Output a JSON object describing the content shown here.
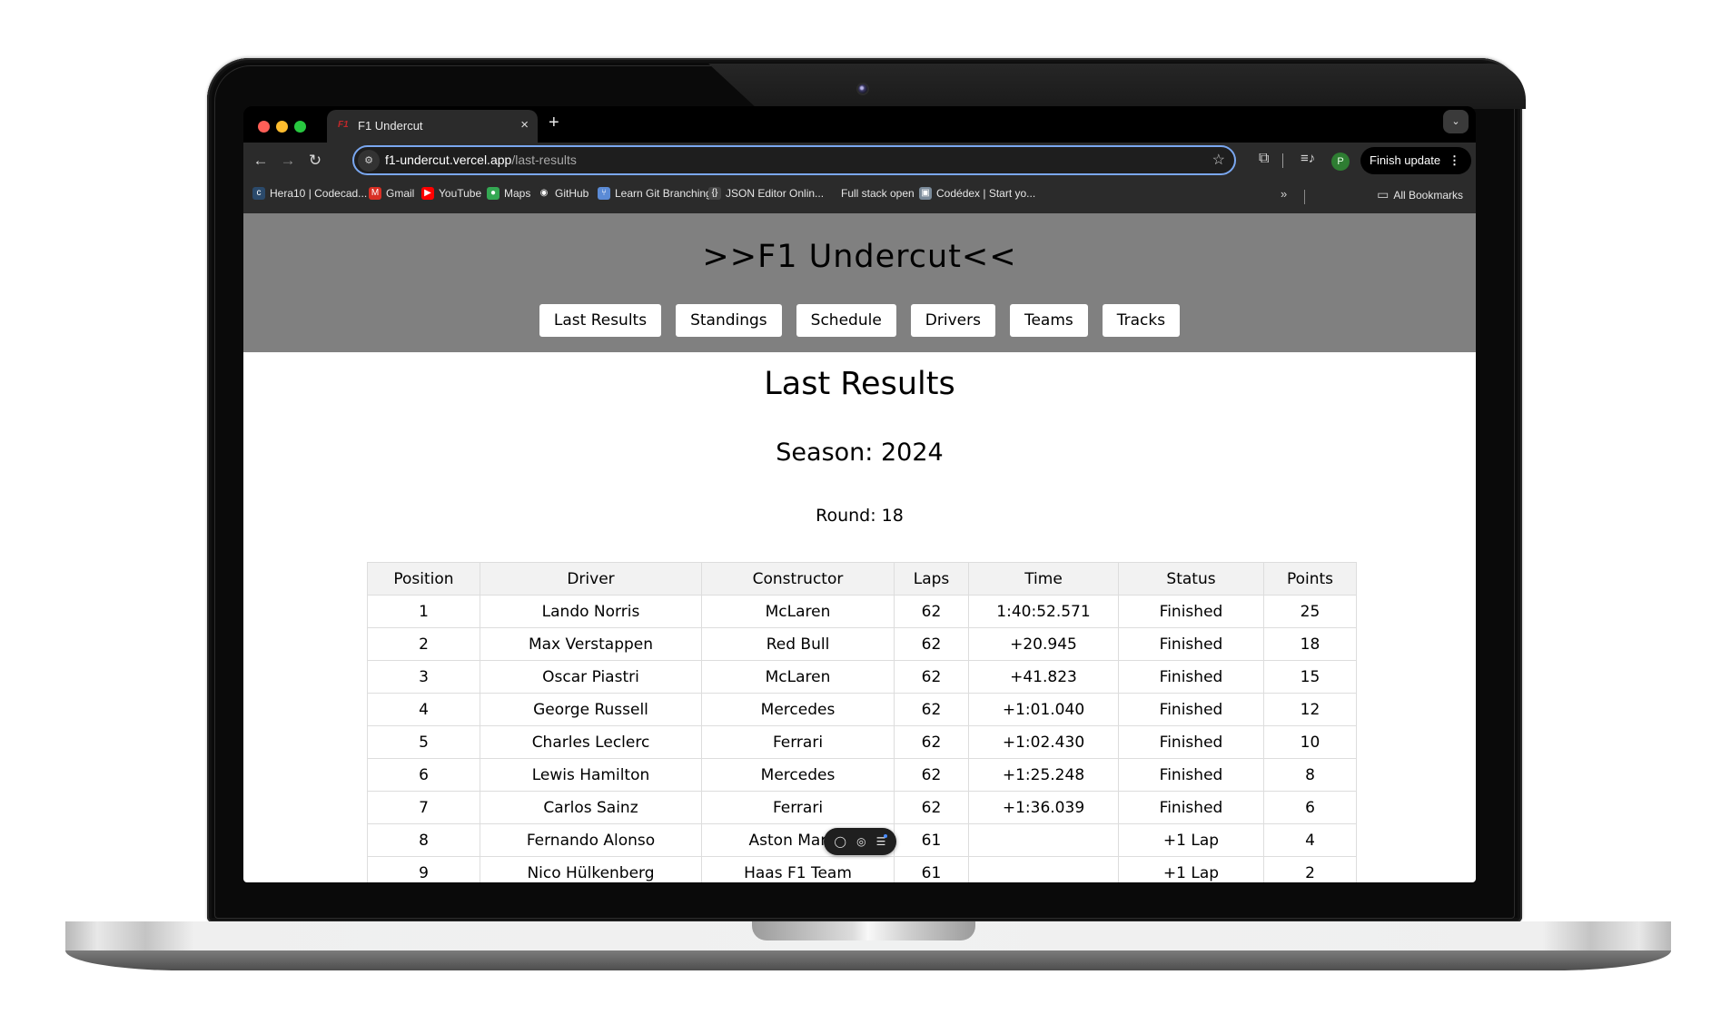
{
  "browser": {
    "tab": {
      "title": "F1 Undercut",
      "favicon": "F1",
      "close": "×"
    },
    "new_tab": "+",
    "tab_search": "⌄",
    "nav": {
      "back": "←",
      "forward": "→",
      "reload": "↻"
    },
    "url": {
      "host": "f1-undercut.vercel.app",
      "path": "/last-results"
    },
    "star": "☆",
    "extensions": "⧉",
    "media": "≡♪",
    "profile_initial": "P",
    "finish_update": "Finish update",
    "menu_dots": "⋮",
    "bookmarks": [
      {
        "label": "Hera10 | Codecad...",
        "icon": "codecademy-icon",
        "glyph": "c",
        "color": "#2b4a6b"
      },
      {
        "label": "Gmail",
        "icon": "gmail-icon",
        "glyph": "M",
        "color": "#d93025"
      },
      {
        "label": "YouTube",
        "icon": "youtube-icon",
        "glyph": "▶",
        "color": "#ff0000"
      },
      {
        "label": "Maps",
        "icon": "maps-pin-icon",
        "glyph": "●",
        "color": "#34a853"
      },
      {
        "label": "GitHub",
        "icon": "github-icon",
        "glyph": "◉",
        "color": "#2b2b2b"
      },
      {
        "label": "Learn Git Branching",
        "icon": "git-branching-icon",
        "glyph": "⑂",
        "color": "#5b8bd6"
      },
      {
        "label": "JSON Editor Onlin...",
        "icon": "braces-icon",
        "glyph": "{}",
        "color": "#444444"
      },
      {
        "label": "Full stack open",
        "icon": "",
        "glyph": "",
        "color": ""
      },
      {
        "label": "Codédex | Start yo...",
        "icon": "codedex-icon",
        "glyph": "▣",
        "color": "#7a8a99"
      }
    ],
    "bookmarks_more": "»",
    "all_bookmarks": "All Bookmarks",
    "folder_icon": "▭"
  },
  "site": {
    "title": ">>F1 Undercut<<",
    "nav": [
      "Last Results",
      "Standings",
      "Schedule",
      "Drivers",
      "Teams",
      "Tracks"
    ]
  },
  "main": {
    "title": "Last Results",
    "season": "Season: 2024",
    "round": "Round: 18",
    "table": {
      "columns": [
        "Position",
        "Driver",
        "Constructor",
        "Laps",
        "Time",
        "Status",
        "Points"
      ],
      "rows": [
        [
          "1",
          "Lando Norris",
          "McLaren",
          "62",
          "1:40:52.571",
          "Finished",
          "25"
        ],
        [
          "2",
          "Max Verstappen",
          "Red Bull",
          "62",
          "+20.945",
          "Finished",
          "18"
        ],
        [
          "3",
          "Oscar Piastri",
          "McLaren",
          "62",
          "+41.823",
          "Finished",
          "15"
        ],
        [
          "4",
          "George Russell",
          "Mercedes",
          "62",
          "+1:01.040",
          "Finished",
          "12"
        ],
        [
          "5",
          "Charles Leclerc",
          "Ferrari",
          "62",
          "+1:02.430",
          "Finished",
          "10"
        ],
        [
          "6",
          "Lewis Hamilton",
          "Mercedes",
          "62",
          "+1:25.248",
          "Finished",
          "8"
        ],
        [
          "7",
          "Carlos Sainz",
          "Ferrari",
          "62",
          "+1:36.039",
          "Finished",
          "6"
        ],
        [
          "8",
          "Fernando Alonso",
          "Aston Martin",
          "61",
          "",
          "+1 Lap",
          "4"
        ],
        [
          "9",
          "Nico Hülkenberg",
          "Haas F1 Team",
          "61",
          "",
          "+1 Lap",
          "2"
        ]
      ]
    }
  },
  "floating_toolbar": {
    "comment": "◯",
    "view": "◎",
    "list": "☰"
  }
}
